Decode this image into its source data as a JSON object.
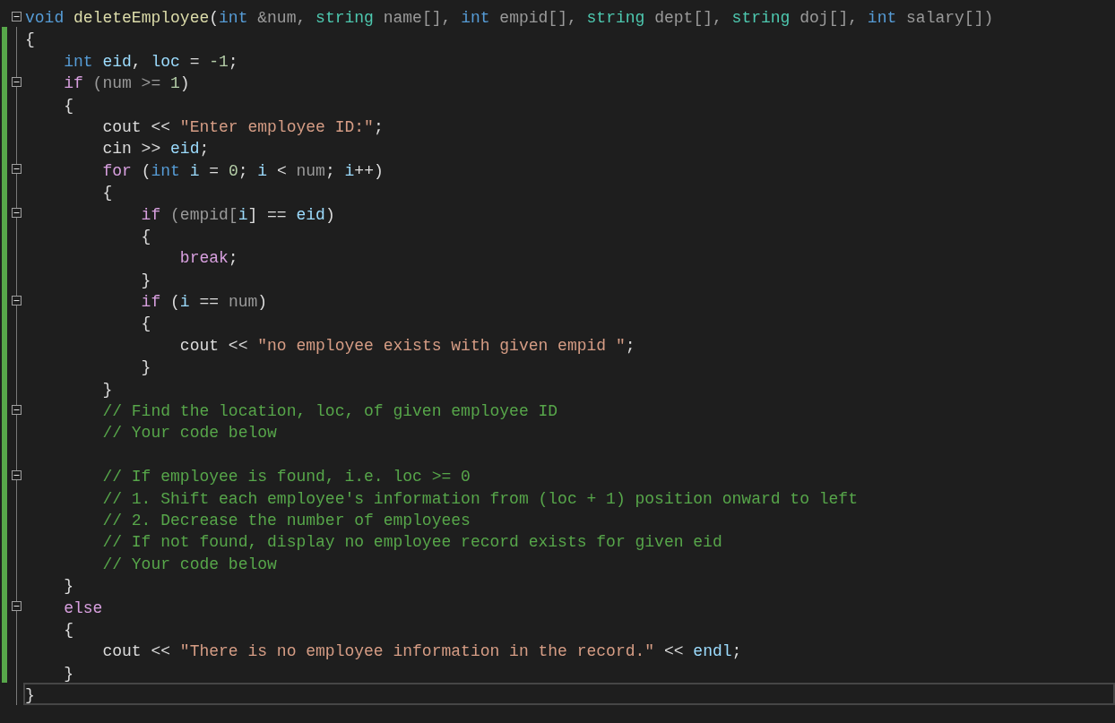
{
  "lines": [
    {
      "fold": true,
      "modified": false,
      "current": false,
      "tokens": [
        {
          "kind": "keyword",
          "text": "void "
        },
        {
          "kind": "function",
          "text": "deleteEmployee"
        },
        {
          "kind": "plain",
          "text": "("
        },
        {
          "kind": "keyword",
          "text": "int"
        },
        {
          "kind": "param",
          "text": " &num, "
        },
        {
          "kind": "type",
          "text": "string"
        },
        {
          "kind": "param",
          "text": " name[], "
        },
        {
          "kind": "keyword",
          "text": "int"
        },
        {
          "kind": "param",
          "text": " empid[], "
        },
        {
          "kind": "type",
          "text": "string"
        },
        {
          "kind": "param",
          "text": " dept[], "
        },
        {
          "kind": "type",
          "text": "string"
        },
        {
          "kind": "param",
          "text": " doj[], "
        },
        {
          "kind": "keyword",
          "text": "int"
        },
        {
          "kind": "param",
          "text": " salary[])"
        }
      ]
    },
    {
      "fold": false,
      "modified": true,
      "current": false,
      "tokens": [
        {
          "kind": "plain",
          "text": "{"
        }
      ]
    },
    {
      "fold": false,
      "modified": true,
      "current": false,
      "tokens": [
        {
          "kind": "keyword",
          "text": "    int "
        },
        {
          "kind": "variable",
          "text": "eid"
        },
        {
          "kind": "plain",
          "text": ", "
        },
        {
          "kind": "variable",
          "text": "loc"
        },
        {
          "kind": "plain",
          "text": " = "
        },
        {
          "kind": "number",
          "text": "-1"
        },
        {
          "kind": "plain",
          "text": ";"
        }
      ]
    },
    {
      "fold": true,
      "modified": true,
      "current": false,
      "tokens": [
        {
          "kind": "control",
          "text": "    if"
        },
        {
          "kind": "param",
          "text": " (num >= "
        },
        {
          "kind": "number",
          "text": "1"
        },
        {
          "kind": "plain",
          "text": ")"
        }
      ]
    },
    {
      "fold": false,
      "modified": true,
      "current": false,
      "tokens": [
        {
          "kind": "plain",
          "text": "    {"
        }
      ]
    },
    {
      "fold": false,
      "modified": true,
      "current": false,
      "tokens": [
        {
          "kind": "plain",
          "text": "        cout << "
        },
        {
          "kind": "string",
          "text": "\"Enter employee ID:\""
        },
        {
          "kind": "plain",
          "text": ";"
        }
      ]
    },
    {
      "fold": false,
      "modified": true,
      "current": false,
      "tokens": [
        {
          "kind": "plain",
          "text": "        cin >> "
        },
        {
          "kind": "variable",
          "text": "eid"
        },
        {
          "kind": "plain",
          "text": ";"
        }
      ]
    },
    {
      "fold": true,
      "modified": true,
      "current": false,
      "tokens": [
        {
          "kind": "control",
          "text": "        for"
        },
        {
          "kind": "plain",
          "text": " ("
        },
        {
          "kind": "keyword",
          "text": "int "
        },
        {
          "kind": "variable",
          "text": "i"
        },
        {
          "kind": "plain",
          "text": " = "
        },
        {
          "kind": "number",
          "text": "0"
        },
        {
          "kind": "plain",
          "text": "; "
        },
        {
          "kind": "variable",
          "text": "i"
        },
        {
          "kind": "plain",
          "text": " < "
        },
        {
          "kind": "param",
          "text": "num"
        },
        {
          "kind": "plain",
          "text": "; "
        },
        {
          "kind": "variable",
          "text": "i"
        },
        {
          "kind": "plain",
          "text": "++)"
        }
      ]
    },
    {
      "fold": false,
      "modified": true,
      "current": false,
      "tokens": [
        {
          "kind": "plain",
          "text": "        {"
        }
      ]
    },
    {
      "fold": true,
      "modified": true,
      "current": false,
      "tokens": [
        {
          "kind": "control",
          "text": "            if"
        },
        {
          "kind": "param",
          "text": " (empid["
        },
        {
          "kind": "variable",
          "text": "i"
        },
        {
          "kind": "plain",
          "text": "] == "
        },
        {
          "kind": "variable",
          "text": "eid"
        },
        {
          "kind": "plain",
          "text": ")"
        }
      ]
    },
    {
      "fold": false,
      "modified": true,
      "current": false,
      "tokens": [
        {
          "kind": "plain",
          "text": "            {"
        }
      ]
    },
    {
      "fold": false,
      "modified": true,
      "current": false,
      "tokens": [
        {
          "kind": "control",
          "text": "                break"
        },
        {
          "kind": "plain",
          "text": ";"
        }
      ]
    },
    {
      "fold": false,
      "modified": true,
      "current": false,
      "tokens": [
        {
          "kind": "plain",
          "text": "            }"
        }
      ]
    },
    {
      "fold": true,
      "modified": true,
      "current": false,
      "tokens": [
        {
          "kind": "control",
          "text": "            if"
        },
        {
          "kind": "plain",
          "text": " ("
        },
        {
          "kind": "variable",
          "text": "i"
        },
        {
          "kind": "plain",
          "text": " == "
        },
        {
          "kind": "param",
          "text": "num"
        },
        {
          "kind": "plain",
          "text": ")"
        }
      ]
    },
    {
      "fold": false,
      "modified": true,
      "current": false,
      "tokens": [
        {
          "kind": "plain",
          "text": "            {"
        }
      ]
    },
    {
      "fold": false,
      "modified": true,
      "current": false,
      "tokens": [
        {
          "kind": "plain",
          "text": "                cout << "
        },
        {
          "kind": "string",
          "text": "\"no employee exists with given empid \""
        },
        {
          "kind": "plain",
          "text": ";"
        }
      ]
    },
    {
      "fold": false,
      "modified": true,
      "current": false,
      "tokens": [
        {
          "kind": "plain",
          "text": "            }"
        }
      ]
    },
    {
      "fold": false,
      "modified": true,
      "current": false,
      "tokens": [
        {
          "kind": "plain",
          "text": "        }"
        }
      ]
    },
    {
      "fold": true,
      "modified": true,
      "current": false,
      "tokens": [
        {
          "kind": "comment",
          "text": "        // Find the location, loc, of given employee ID"
        }
      ]
    },
    {
      "fold": false,
      "modified": true,
      "current": false,
      "tokens": [
        {
          "kind": "comment",
          "text": "        // Your code below"
        }
      ]
    },
    {
      "fold": false,
      "modified": true,
      "current": false
    },
    {
      "fold": true,
      "modified": true,
      "current": false,
      "tokens": [
        {
          "kind": "comment",
          "text": "        // If employee is found, i.e. loc >= 0"
        }
      ]
    },
    {
      "fold": false,
      "modified": true,
      "current": false,
      "tokens": [
        {
          "kind": "comment",
          "text": "        // 1. Shift each employee's information from (loc + 1) position onward to left"
        }
      ]
    },
    {
      "fold": false,
      "modified": true,
      "current": false,
      "tokens": [
        {
          "kind": "comment",
          "text": "        // 2. Decrease the number of employees"
        }
      ]
    },
    {
      "fold": false,
      "modified": true,
      "current": false,
      "tokens": [
        {
          "kind": "comment",
          "text": "        // If not found, display no employee record exists for given eid"
        }
      ]
    },
    {
      "fold": false,
      "modified": true,
      "current": false,
      "tokens": [
        {
          "kind": "comment",
          "text": "        // Your code below"
        }
      ]
    },
    {
      "fold": false,
      "modified": true,
      "current": false,
      "tokens": [
        {
          "kind": "plain",
          "text": "    }"
        }
      ]
    },
    {
      "fold": true,
      "modified": true,
      "current": false,
      "tokens": [
        {
          "kind": "control",
          "text": "    else"
        }
      ]
    },
    {
      "fold": false,
      "modified": true,
      "current": false,
      "tokens": [
        {
          "kind": "plain",
          "text": "    {"
        }
      ]
    },
    {
      "fold": false,
      "modified": true,
      "current": false,
      "tokens": [
        {
          "kind": "plain",
          "text": "        cout << "
        },
        {
          "kind": "string",
          "text": "\"There is no employee information in the record.\""
        },
        {
          "kind": "plain",
          "text": " << "
        },
        {
          "kind": "variable",
          "text": "endl"
        },
        {
          "kind": "plain",
          "text": ";"
        }
      ]
    },
    {
      "fold": false,
      "modified": true,
      "current": false,
      "tokens": [
        {
          "kind": "plain",
          "text": "    }"
        }
      ]
    },
    {
      "fold": false,
      "modified": false,
      "current": true,
      "tokens": [
        {
          "kind": "plain",
          "text": "}"
        }
      ]
    }
  ]
}
